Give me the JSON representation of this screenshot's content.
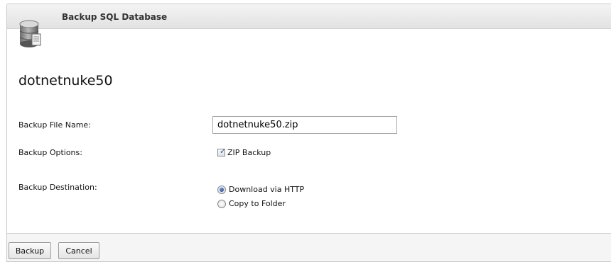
{
  "panel": {
    "title": "Backup SQL Database",
    "icon": "database-icon"
  },
  "database_name": "dotnetnuke50",
  "form": {
    "file_name_label": "Backup File Name:",
    "file_name_value": "dotnetnuke50.zip",
    "options_label": "Backup Options:",
    "zip_backup_label": "ZIP Backup",
    "zip_backup_checked": true,
    "destination_label": "Backup Destination:",
    "destination_options": [
      {
        "label": "Download via HTTP",
        "selected": true
      },
      {
        "label": "Copy to Folder",
        "selected": false
      }
    ]
  },
  "buttons": {
    "backup": "Backup",
    "cancel": "Cancel"
  }
}
